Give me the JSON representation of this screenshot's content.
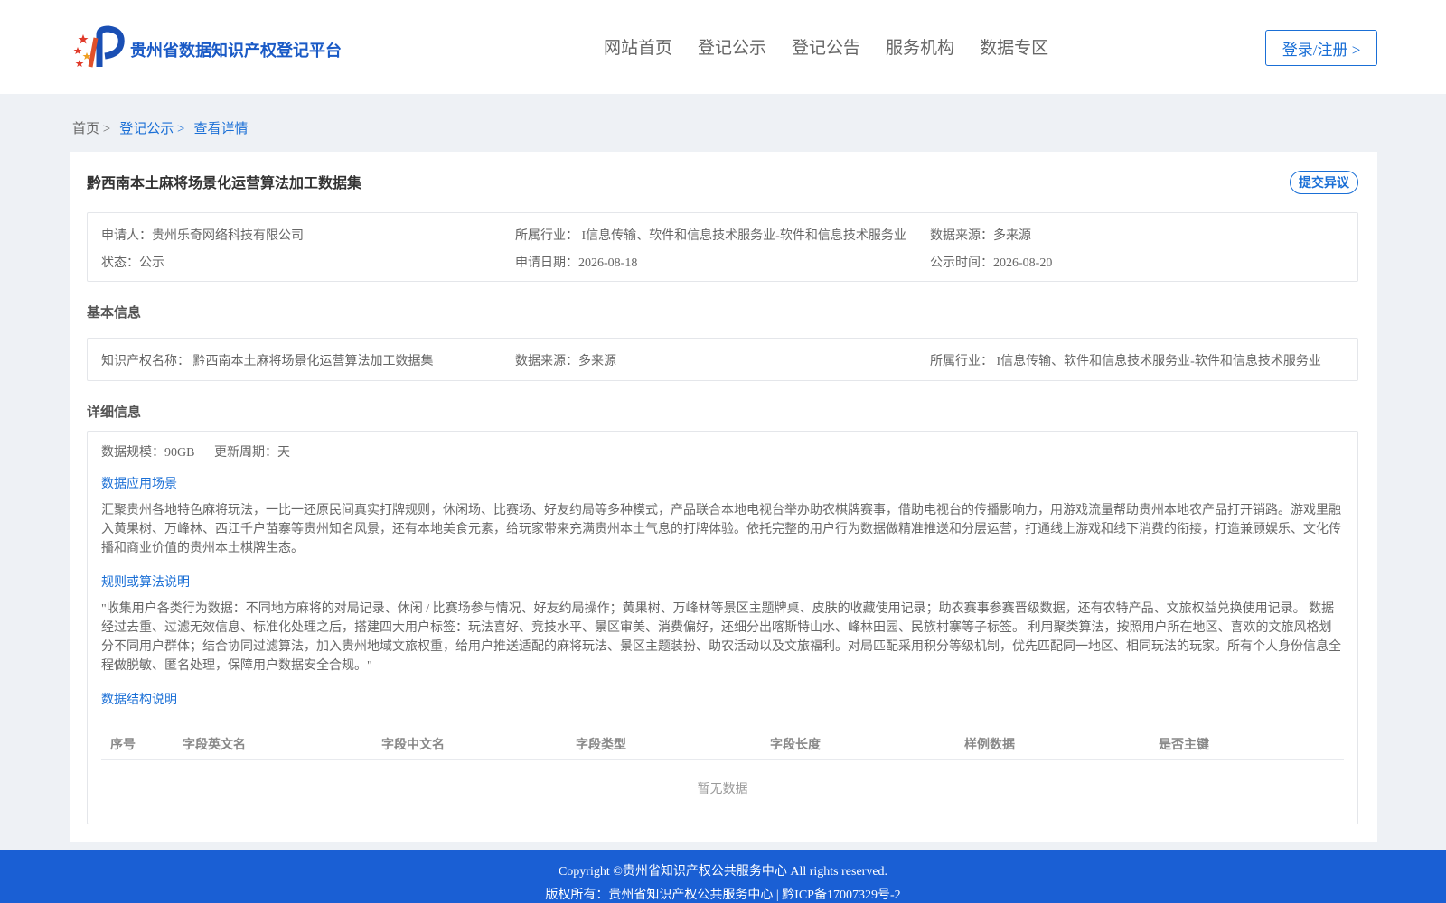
{
  "header": {
    "site_title": "贵州省数据知识产权登记平台",
    "nav": [
      "网站首页",
      "登记公示",
      "登记公告",
      "服务机构",
      "数据专区"
    ],
    "login_label": "登录/注册 >"
  },
  "breadcrumb": {
    "home": "首页 >",
    "list": "登记公示 >",
    "current": "查看详情"
  },
  "detail": {
    "title": "黔西南本土麻将场景化运营算法加工数据集",
    "objection_label": "提交异议",
    "meta": {
      "applicant": "申请人：贵州乐奇网络科技有限公司",
      "industry": "所属行业： I信息传输、软件和信息技术服务业-软件和信息技术服务业",
      "source": "数据来源：多来源",
      "status": "状态：公示",
      "apply_date": "申请日期：2026-08-18",
      "publish_date": "公示时间：2026-08-20"
    },
    "basic_title": "基本信息",
    "basic": {
      "ip_name": "知识产权名称： 黔西南本土麻将场景化运营算法加工数据集",
      "source": "数据来源：多来源",
      "industry": "所属行业： I信息传输、软件和信息技术服务业-软件和信息技术服务业"
    },
    "detail_title": "详细信息",
    "scale": "数据规模：90GB",
    "cycle": "更新周期：天",
    "scenario_title": "数据应用场景",
    "scenario_text": "汇聚贵州各地特色麻将玩法，一比一还原民间真实打牌规则，休闲场、比赛场、好友约局等多种模式，产品联合本地电视台举办助农棋牌赛事，借助电视台的传播影响力，用游戏流量帮助贵州本地农产品打开销路。游戏里融入黄果树、万峰林、西江千户苗寨等贵州知名风景，还有本地美食元素，给玩家带来充满贵州本土气息的打牌体验。依托完整的用户行为数据做精准推送和分层运营，打通线上游戏和线下消费的衔接，打造兼顾娱乐、文化传播和商业价值的贵州本土棋牌生态。",
    "rule_title": "规则或算法说明",
    "rule_text": "\"收集用户各类行为数据：不同地方麻将的对局记录、休闲 / 比赛场参与情况、好友约局操作；黄果树、万峰林等景区主题牌桌、皮肤的收藏使用记录；助农赛事参赛晋级数据，还有农特产品、文旅权益兑换使用记录。 数据经过去重、过滤无效信息、标准化处理之后，搭建四大用户标签：玩法喜好、竞技水平、景区审美、消费偏好，还细分出喀斯特山水、峰林田园、民族村寨等子标签。 利用聚类算法，按照用户所在地区、喜欢的文旅风格划分不同用户群体；结合协同过滤算法，加入贵州地域文旅权重，给用户推送适配的麻将玩法、景区主题装扮、助农活动以及文旅福利。对局匹配采用积分等级机制，优先匹配同一地区、相同玩法的玩家。所有个人身份信息全程做脱敏、匿名处理，保障用户数据安全合规。\"",
    "structure_title": "数据结构说明",
    "table": {
      "headers": [
        "序号",
        "字段英文名",
        "字段中文名",
        "字段类型",
        "字段长度",
        "样例数据",
        "是否主键"
      ],
      "empty_text": "暂无数据"
    }
  },
  "footer": {
    "copyright": "Copyright ©贵州省知识产权公共服务中心 All rights reserved.",
    "owner": "版权所有：贵州省知识产权公共服务中心 | 黔ICP备17007329号-2"
  }
}
